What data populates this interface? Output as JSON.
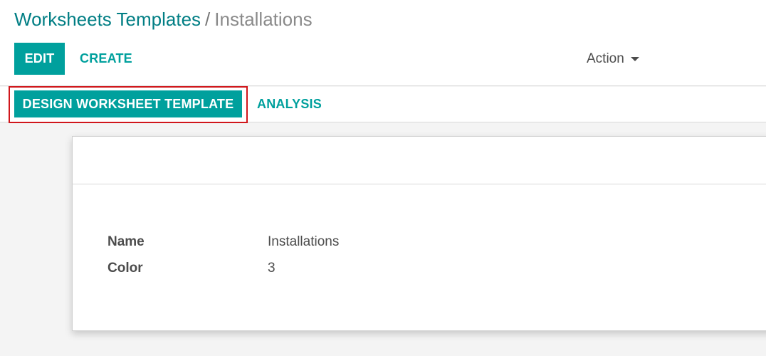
{
  "breadcrumb": {
    "parent": "Worksheets Templates",
    "separator": "/",
    "current": "Installations"
  },
  "toolbar": {
    "edit_label": "EDIT",
    "create_label": "CREATE",
    "action_label": "Action"
  },
  "statusbar": {
    "design_label": "DESIGN WORKSHEET TEMPLATE",
    "analysis_label": "ANALYSIS"
  },
  "form": {
    "fields": [
      {
        "label": "Name",
        "value": "Installations"
      },
      {
        "label": "Color",
        "value": "3"
      }
    ]
  },
  "colors": {
    "primary": "#00a09d",
    "breadcrumb_link": "#017e84",
    "highlight": "#d0161b"
  },
  "icons": {
    "action_caret": "chevron-down-icon"
  }
}
